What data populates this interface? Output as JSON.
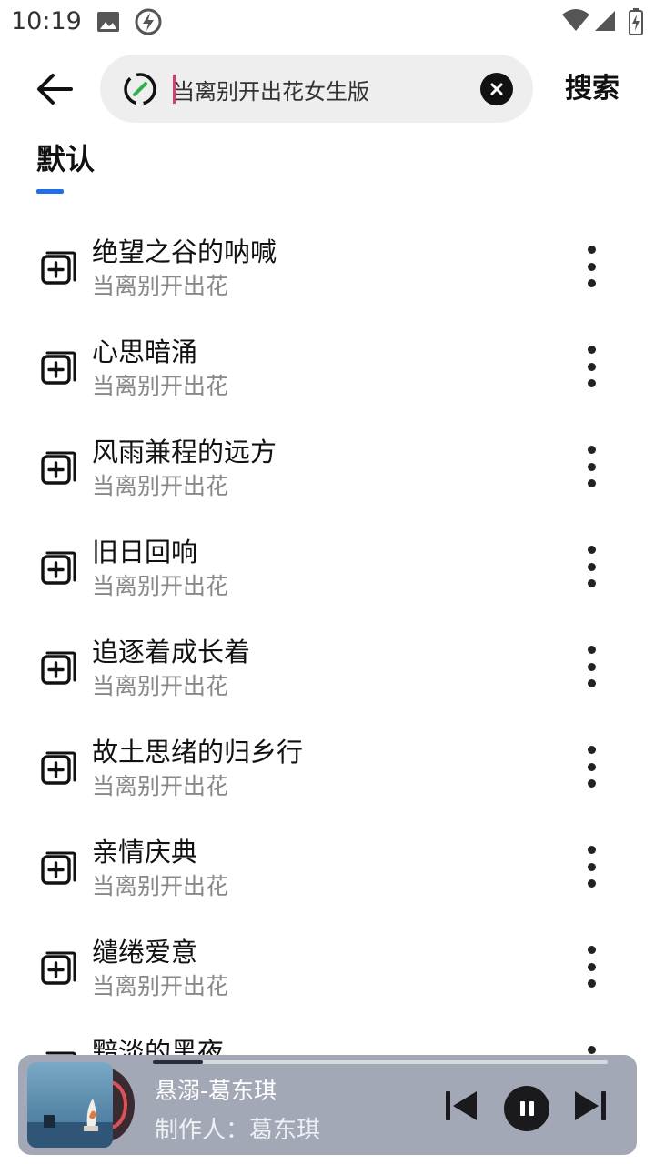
{
  "status_bar": {
    "time": "10:19"
  },
  "header": {
    "search": {
      "query": "当离别开出花女生版"
    },
    "search_button_label": "搜索"
  },
  "tabs": [
    {
      "label": "默认"
    }
  ],
  "songs": [
    {
      "title": "绝望之谷的呐喊",
      "artist": "当离别开出花"
    },
    {
      "title": "心思暗涌",
      "artist": "当离别开出花"
    },
    {
      "title": "风雨兼程的远方",
      "artist": "当离别开出花"
    },
    {
      "title": "旧日回响",
      "artist": "当离别开出花"
    },
    {
      "title": "追逐着成长着",
      "artist": "当离别开出花"
    },
    {
      "title": "故土思绪的归乡行",
      "artist": "当离别开出花"
    },
    {
      "title": "亲情庆典",
      "artist": "当离别开出花"
    },
    {
      "title": "缱绻爱意",
      "artist": "当离别开出花"
    },
    {
      "title": "黯淡的黑夜",
      "artist": ""
    }
  ],
  "player": {
    "title": "悬溺-葛东琪",
    "author": "制作人：葛东琪",
    "progress": 0.11
  },
  "colors": {
    "accent": "#1f6feb",
    "caret": "#e03a6a",
    "link_icon": "#2bb24c",
    "player_bg": "#a3a8b7"
  }
}
